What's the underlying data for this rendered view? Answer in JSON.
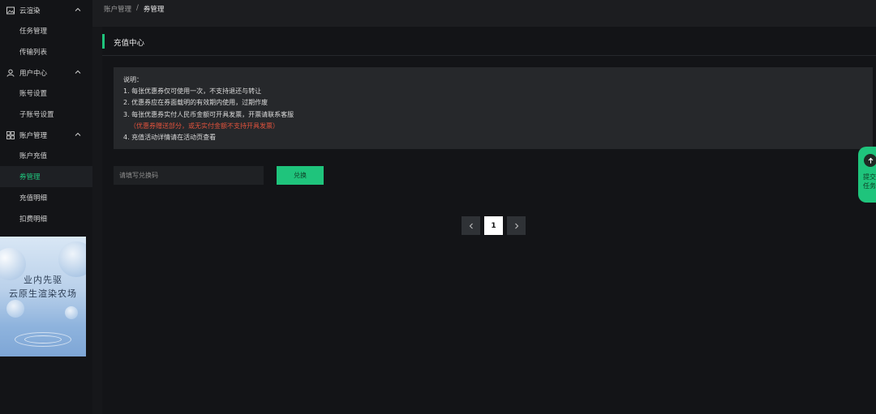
{
  "sidebar": {
    "groups": [
      {
        "label": "云渲染",
        "icon": "image-icon",
        "items": [
          {
            "label": "任务管理"
          },
          {
            "label": "传输列表"
          }
        ]
      },
      {
        "label": "用户中心",
        "icon": "user-icon",
        "items": [
          {
            "label": "账号设置"
          },
          {
            "label": "子账号设置"
          }
        ]
      },
      {
        "label": "账户管理",
        "icon": "grid-icon",
        "items": [
          {
            "label": "账户充值"
          },
          {
            "label": "券管理"
          },
          {
            "label": "充值明细"
          },
          {
            "label": "扣费明细"
          }
        ]
      }
    ],
    "active_item": "券管理",
    "promo": {
      "line1": "业内先驱",
      "line2": "云原生渲染农场"
    }
  },
  "breadcrumb": {
    "parent": "账户管理",
    "separator": "/",
    "current": "券管理"
  },
  "section": {
    "title": "充值中心"
  },
  "notice": {
    "lines": [
      "说明：",
      "1. 每张优惠券仅可使用一次，不支持退还与转让",
      "2. 优惠券应在券面载明的有效期内使用，过期作废",
      "3. 每张优惠券实付人民币金额可开具发票，开票请联系客服",
      "（优惠券赠送部分，或无实付金额不支持开具发票）",
      "4. 充值活动详情请在活动页查看"
    ],
    "highlight_color": "#e0523c"
  },
  "redeem": {
    "placeholder": "请填写兑换码",
    "button_label": "兑换"
  },
  "pagination": {
    "current_page": "1"
  },
  "float_tab": {
    "line1": "提交",
    "line2": "任务"
  },
  "colors": {
    "accent": "#1fc47c",
    "background": "#131417"
  }
}
